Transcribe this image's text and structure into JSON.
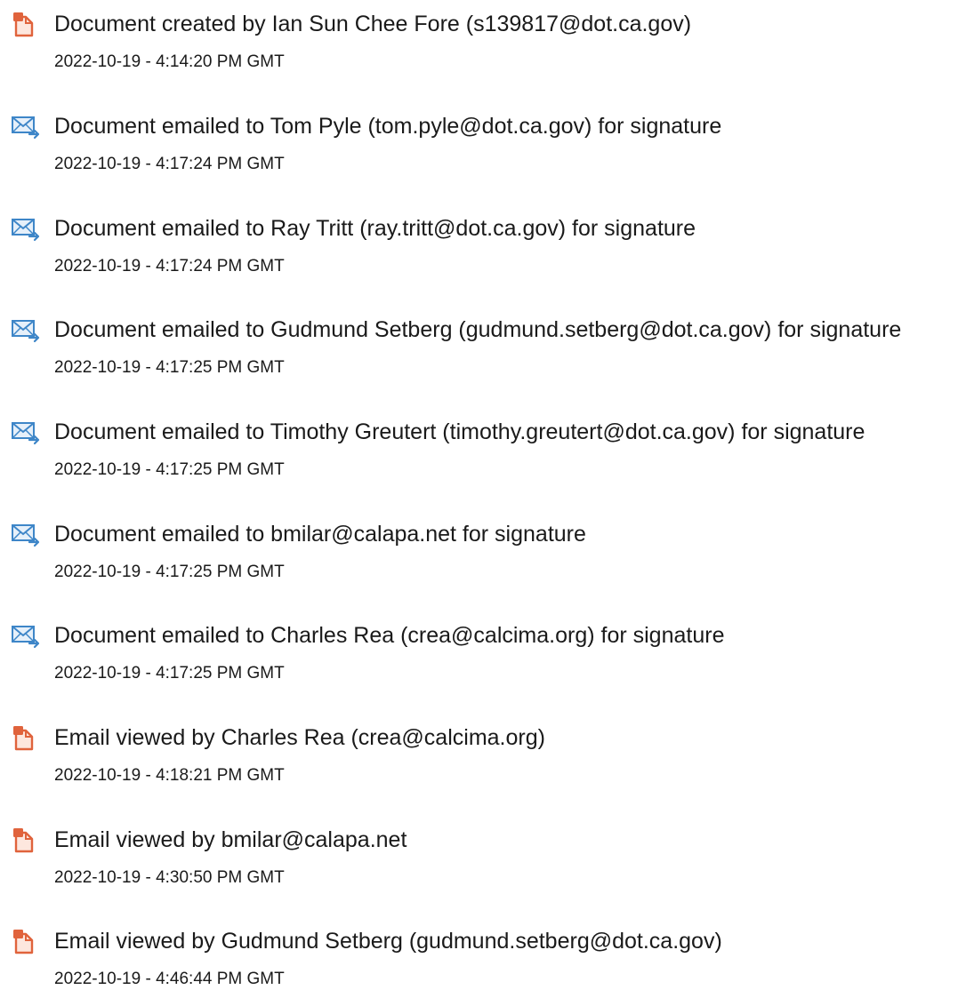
{
  "colors": {
    "doc_icon": "#e0633c",
    "doc_icon_fill": "#fde7de",
    "email_icon": "#3e86c8",
    "email_icon_fill": "#e6f0fa",
    "text": "#1a1a1a"
  },
  "events": [
    {
      "icon": "document-icon",
      "title": "Document created by Ian Sun Chee Fore (s139817@dot.ca.gov)",
      "timestamp": "2022-10-19 - 4:14:20 PM GMT"
    },
    {
      "icon": "email-sent-icon",
      "title": "Document emailed to Tom Pyle (tom.pyle@dot.ca.gov) for signature",
      "timestamp": "2022-10-19 - 4:17:24 PM GMT"
    },
    {
      "icon": "email-sent-icon",
      "title": "Document emailed to Ray Tritt (ray.tritt@dot.ca.gov) for signature",
      "timestamp": "2022-10-19 - 4:17:24 PM GMT"
    },
    {
      "icon": "email-sent-icon",
      "title": "Document emailed to Gudmund Setberg (gudmund.setberg@dot.ca.gov) for signature",
      "timestamp": "2022-10-19 - 4:17:25 PM GMT"
    },
    {
      "icon": "email-sent-icon",
      "title": "Document emailed to Timothy Greutert (timothy.greutert@dot.ca.gov) for signature",
      "timestamp": "2022-10-19 - 4:17:25 PM GMT"
    },
    {
      "icon": "email-sent-icon",
      "title": "Document emailed to bmilar@calapa.net for signature",
      "timestamp": "2022-10-19 - 4:17:25 PM GMT"
    },
    {
      "icon": "email-sent-icon",
      "title": "Document emailed to Charles Rea (crea@calcima.org) for signature",
      "timestamp": "2022-10-19 - 4:17:25 PM GMT"
    },
    {
      "icon": "document-icon",
      "title": "Email viewed by Charles Rea (crea@calcima.org)",
      "timestamp": "2022-10-19 - 4:18:21 PM GMT"
    },
    {
      "icon": "document-icon",
      "title": "Email viewed by bmilar@calapa.net",
      "timestamp": "2022-10-19 - 4:30:50 PM GMT"
    },
    {
      "icon": "document-icon",
      "title": "Email viewed by Gudmund Setberg (gudmund.setberg@dot.ca.gov)",
      "timestamp": "2022-10-19 - 4:46:44 PM GMT"
    }
  ]
}
